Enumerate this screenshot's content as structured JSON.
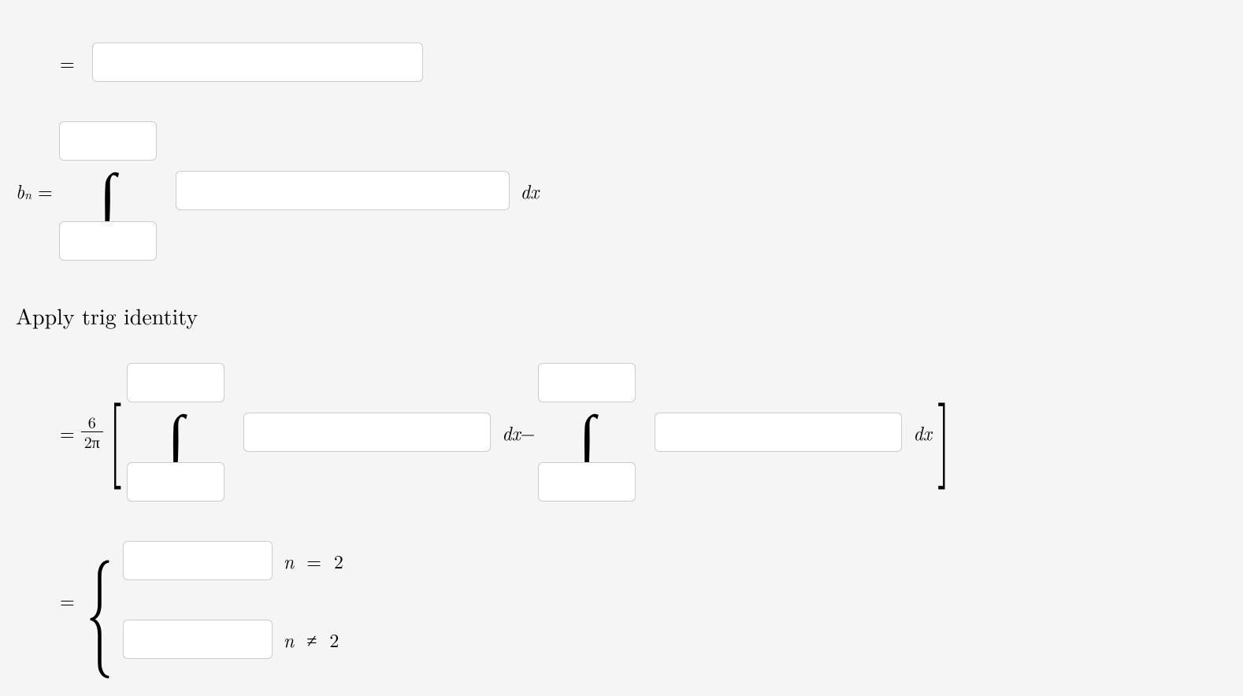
{
  "line1": {
    "prefix": "=",
    "input_value": ""
  },
  "line2": {
    "lhs_base": "b",
    "lhs_sub": "n",
    "eq": "=",
    "upper_value": "",
    "lower_value": "",
    "integrand_value": "",
    "dx": "dx"
  },
  "prose": "Apply trig identity",
  "line3": {
    "prefix": "=",
    "frac_num": "6",
    "frac_den": "2π",
    "first_upper_value": "",
    "first_lower_value": "",
    "first_integrand_value": "",
    "dx1": "dx",
    "minus": "−",
    "second_upper_value": "",
    "second_lower_value": "",
    "second_integrand_value": "",
    "dx2": "dx"
  },
  "line4": {
    "prefix": "=",
    "case1_value": "",
    "case1_cond_lhs": "n",
    "case1_cond_op": "=",
    "case1_cond_rhs": "2",
    "case2_value": "",
    "case2_cond_lhs": "n",
    "case2_cond_op": "≠",
    "case2_cond_rhs": "2"
  }
}
